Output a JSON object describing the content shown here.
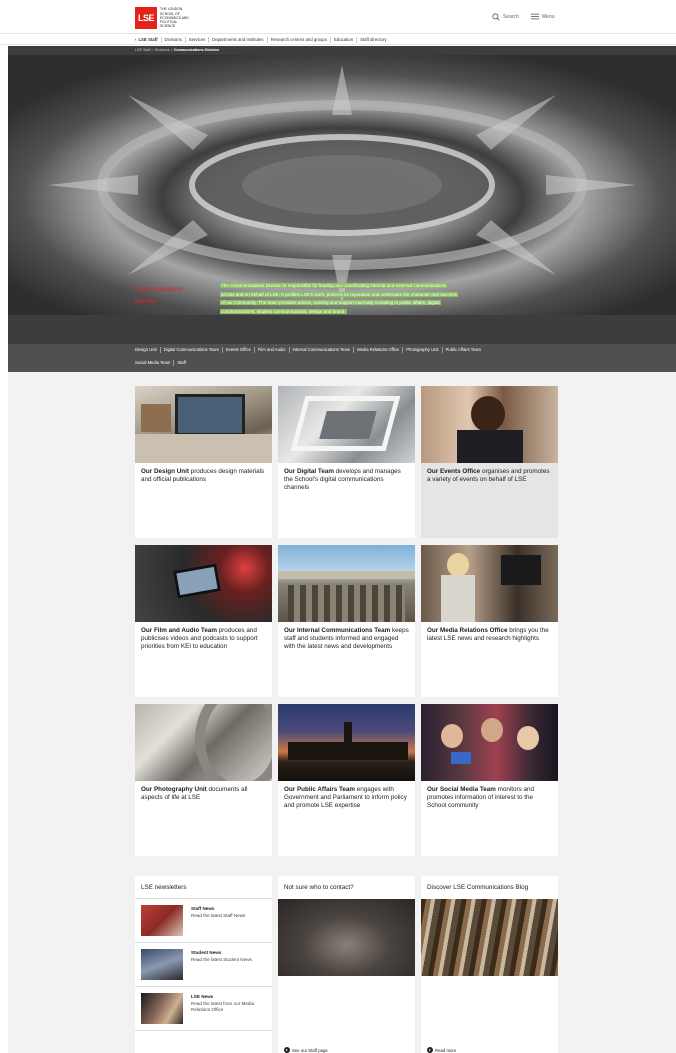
{
  "header": {
    "logo_mark": "LSE",
    "logo_text": "The London School of Economics and Political Science",
    "search_label": "Search",
    "menu_label": "Menu"
  },
  "nav": {
    "back_label": "LSE Staff",
    "items": [
      "Divisions",
      "Services",
      "Departments and Institutes",
      "Research centres and groups",
      "Education",
      "Staff directory"
    ]
  },
  "breadcrumb": {
    "items": [
      "LSE Staff",
      "Divisions"
    ],
    "current": "Communications Division",
    "separator": ">"
  },
  "hero": {
    "title_line1": "Communications",
    "title_line2": "Division",
    "description": "The Communications Division is responsible for leading and coordinating internal and external communications across and on behalf of LSE. It profiles LSE's work, protects its reputation and celebrates the character and success of our community. The team provides advice, training and support internally including in public affairs, digital communications, student communications, design and brand.",
    "highlight_color": "#8bbf5d",
    "title_color": "#e2231a"
  },
  "subnav": {
    "row1": [
      "Design Unit",
      "Digital Communications Team",
      "Events Office",
      "Film and Audio",
      "Internal Communications Team",
      "Media Relations Office",
      "Photography Unit",
      "Public Affairs Team"
    ],
    "row2": [
      "Social Media Team",
      "Staff"
    ]
  },
  "cards": [
    {
      "bold": "Our Design Unit",
      "text": " produces design materials and official publications"
    },
    {
      "bold": "Our Digital Team",
      "text": " develops and manages the School's digital communications channels"
    },
    {
      "bold": "Our Events Office",
      "text": " organises and promotes a variety of events on behalf of LSE"
    },
    {
      "bold": "Our Film and Audio Team",
      "text": " produces and publicises videos and podcasts to support priorities from KEI to education"
    },
    {
      "bold": "Our Internal Communications Team",
      "text": " keeps staff and students informed and engaged with the latest news and developments"
    },
    {
      "bold": "Our Media Relations Office",
      "text": " brings you the latest LSE news and research highlights"
    },
    {
      "bold": "Our Photography Unit",
      "text": " documents all aspects of life at LSE"
    },
    {
      "bold": "Our Public Affairs Team",
      "text": " engages with Government and Parliament to inform policy and promote LSE expertise"
    },
    {
      "bold": "Our Social Media Team",
      "text": " monitors and promotes information of interest to the School community"
    }
  ],
  "newsletters": {
    "heading": "LSE newsletters",
    "items": [
      {
        "title": "Staff News",
        "desc": "Read the latest Staff News"
      },
      {
        "title": "Student News",
        "desc": "Read the latest Student News"
      },
      {
        "title": "LSE News",
        "desc": "Read the latest from our Media Relations Office"
      }
    ]
  },
  "contact": {
    "heading": "Not sure who to contact?",
    "link": "See our Staff page"
  },
  "blog": {
    "heading": "Discover LSE Communications Blog",
    "link": "Read more"
  }
}
